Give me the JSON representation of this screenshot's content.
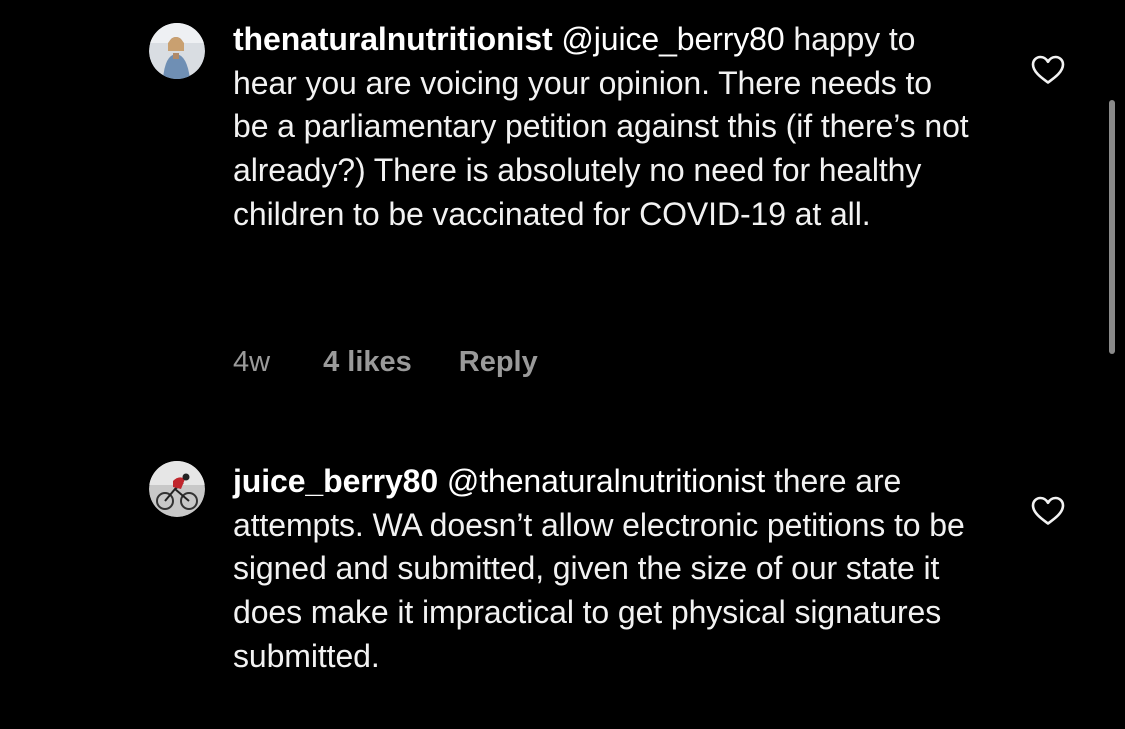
{
  "comments": [
    {
      "username": "thenaturalnutritionist",
      "mention": "@juice_berry80",
      "text": "happy to hear you are voicing your opinion. There needs to be a parliamentary petition against this (if there’s not already?) There is absolutely no need for healthy children to be vaccinated for COVID-19 at all.",
      "time": "4w",
      "likes": "4 likes",
      "reply_label": "Reply",
      "avatar_icon": "profile-photo-woman",
      "like_icon": "heart-outline-icon"
    },
    {
      "username": "juice_berry80",
      "mention": "@thenaturalnutritionist",
      "text": "there are attempts. WA doesn’t allow electronic petitions to be signed and submitted, given the size of our state it does make it impractical to get physical signatures submitted.",
      "avatar_icon": "profile-photo-cyclist",
      "like_icon": "heart-outline-icon"
    }
  ],
  "colors": {
    "background": "#000000",
    "text": "#f2f2f2",
    "meta": "#9a9a9a",
    "scrollbar": "#8a8a8a"
  }
}
